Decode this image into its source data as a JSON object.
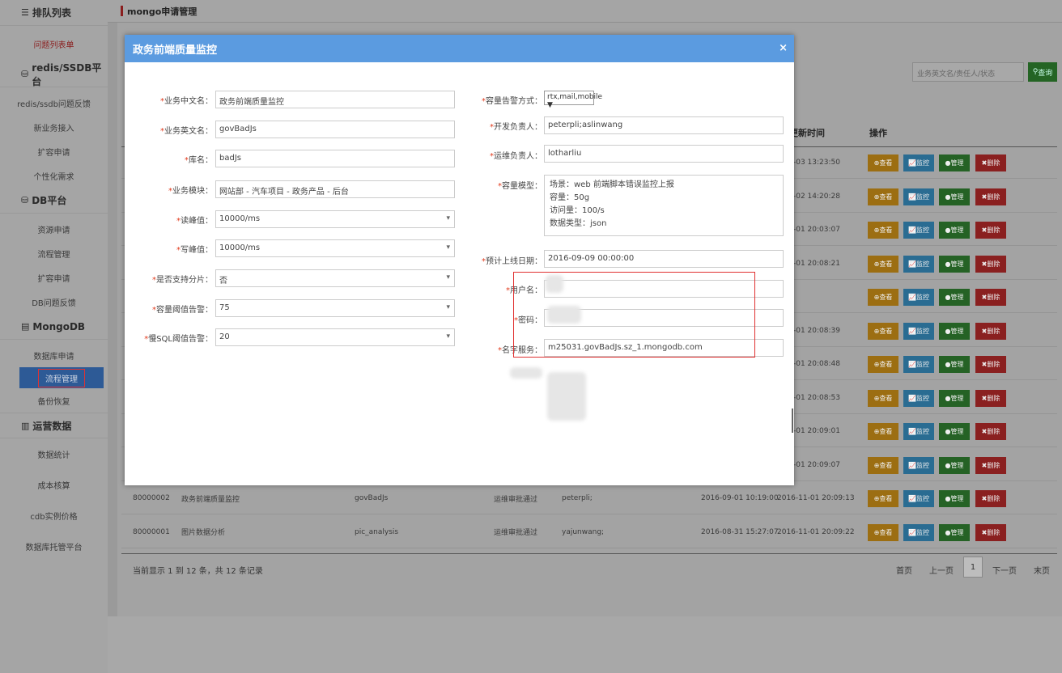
{
  "sidebar": {
    "queue_head": "排队列表",
    "queue_item": "问题列表单",
    "redis_head": "redis/SSDB平台",
    "redis_items": [
      "redis/ssdb问题反馈",
      "新业务接入",
      "扩容申请",
      "个性化需求"
    ],
    "db_head": "DB平台",
    "db_items": [
      "资源申请",
      "流程管理",
      "扩容申请",
      "DB问题反馈"
    ],
    "mongo_head": "MongoDB",
    "mongo_items": [
      "数据库申请",
      "流程管理",
      "备份恢复"
    ],
    "ops_head": "运营数据",
    "ops_items": [
      "数据统计",
      "成本核算",
      "cdb实例价格",
      "数据库托管平台"
    ]
  },
  "topbar": {
    "title": "mongo申请管理"
  },
  "search": {
    "placeholder": "业务英文名/责任人/状态",
    "button": "查询"
  },
  "table": {
    "headers": {
      "update_time": "更新时间",
      "actions": "操作"
    },
    "update_times_partial": [
      "-03 13:23:50",
      "-02 14:20:28",
      "-01 20:03:07",
      "-01 20:08:21",
      "",
      "-01 20:08:39",
      "-01 20:08:48",
      "-01 20:08:53",
      "-01 20:09:01",
      "-01 20:09:07"
    ],
    "rows": [
      {
        "id": "80000002",
        "name": "政务前端质量监控",
        "en": "govBadJs",
        "status": "运维审批通过",
        "owner": "peterpli;",
        "created": "2016-09-01 10:19:00",
        "updated": "2016-11-01 20:09:13"
      },
      {
        "id": "80000001",
        "name": "图片数据分析",
        "en": "pic_analysis",
        "status": "运维审批通过",
        "owner": "yajunwang;",
        "created": "2016-08-31 15:27:07",
        "updated": "2016-11-01 20:09:22"
      }
    ],
    "actions": {
      "view": "⊕查看",
      "monitor": "📈监控",
      "manage": "●管理",
      "delete": "✖删除"
    },
    "footer": "当前显示 1 到 12 条，共 12 条记录",
    "pager": {
      "first": "首页",
      "prev": "上一页",
      "current": "1",
      "next": "下一页",
      "last": "末页"
    }
  },
  "modal": {
    "title": "政务前端质量监控",
    "close": "×",
    "left": [
      {
        "label": "业务中文名：",
        "value": "政务前端质量监控",
        "select": false
      },
      {
        "label": "业务英文名：",
        "value": "govBadJs",
        "select": false
      },
      {
        "label": "库名：",
        "value": "badJs",
        "select": false
      },
      {
        "label": "业务模块：",
        "value": "网站部 - 汽车项目 - 政务产品 - 后台",
        "select": false
      },
      {
        "label": "读峰值：",
        "value": "10000/ms",
        "select": true
      },
      {
        "label": "写峰值：",
        "value": "10000/ms",
        "select": true
      },
      {
        "label": "是否支持分片：",
        "value": "否",
        "select": true
      },
      {
        "label": "容量阈值告警：",
        "value": "75",
        "select": true
      },
      {
        "label": "慢SQL阈值告警：",
        "value": "20",
        "select": true
      }
    ],
    "alert_label": "容量告警方式：",
    "alert_value": "rtx,mail,mobile ▼",
    "dev_label": "开发负责人：",
    "dev_value": "peterpli;aslinwang",
    "ops_label": "运维负责人：",
    "ops_value": "lotharliu",
    "capacity_label": "容量模型：",
    "capacity_lines": [
      "场景：web 前端脚本错误监控上报",
      "容量：50g",
      "访问量：100/s",
      "数据类型：json"
    ],
    "launch_label": "预计上线日期：",
    "launch_value": "2016-09-09 00:00:00",
    "user_label": "用户名：",
    "user_value": "",
    "pwd_label": "密码：",
    "pwd_value": "",
    "ns_label": "名字服务：",
    "ns_value": "m25031.govBadJs.sz_1.mongodb.com"
  }
}
